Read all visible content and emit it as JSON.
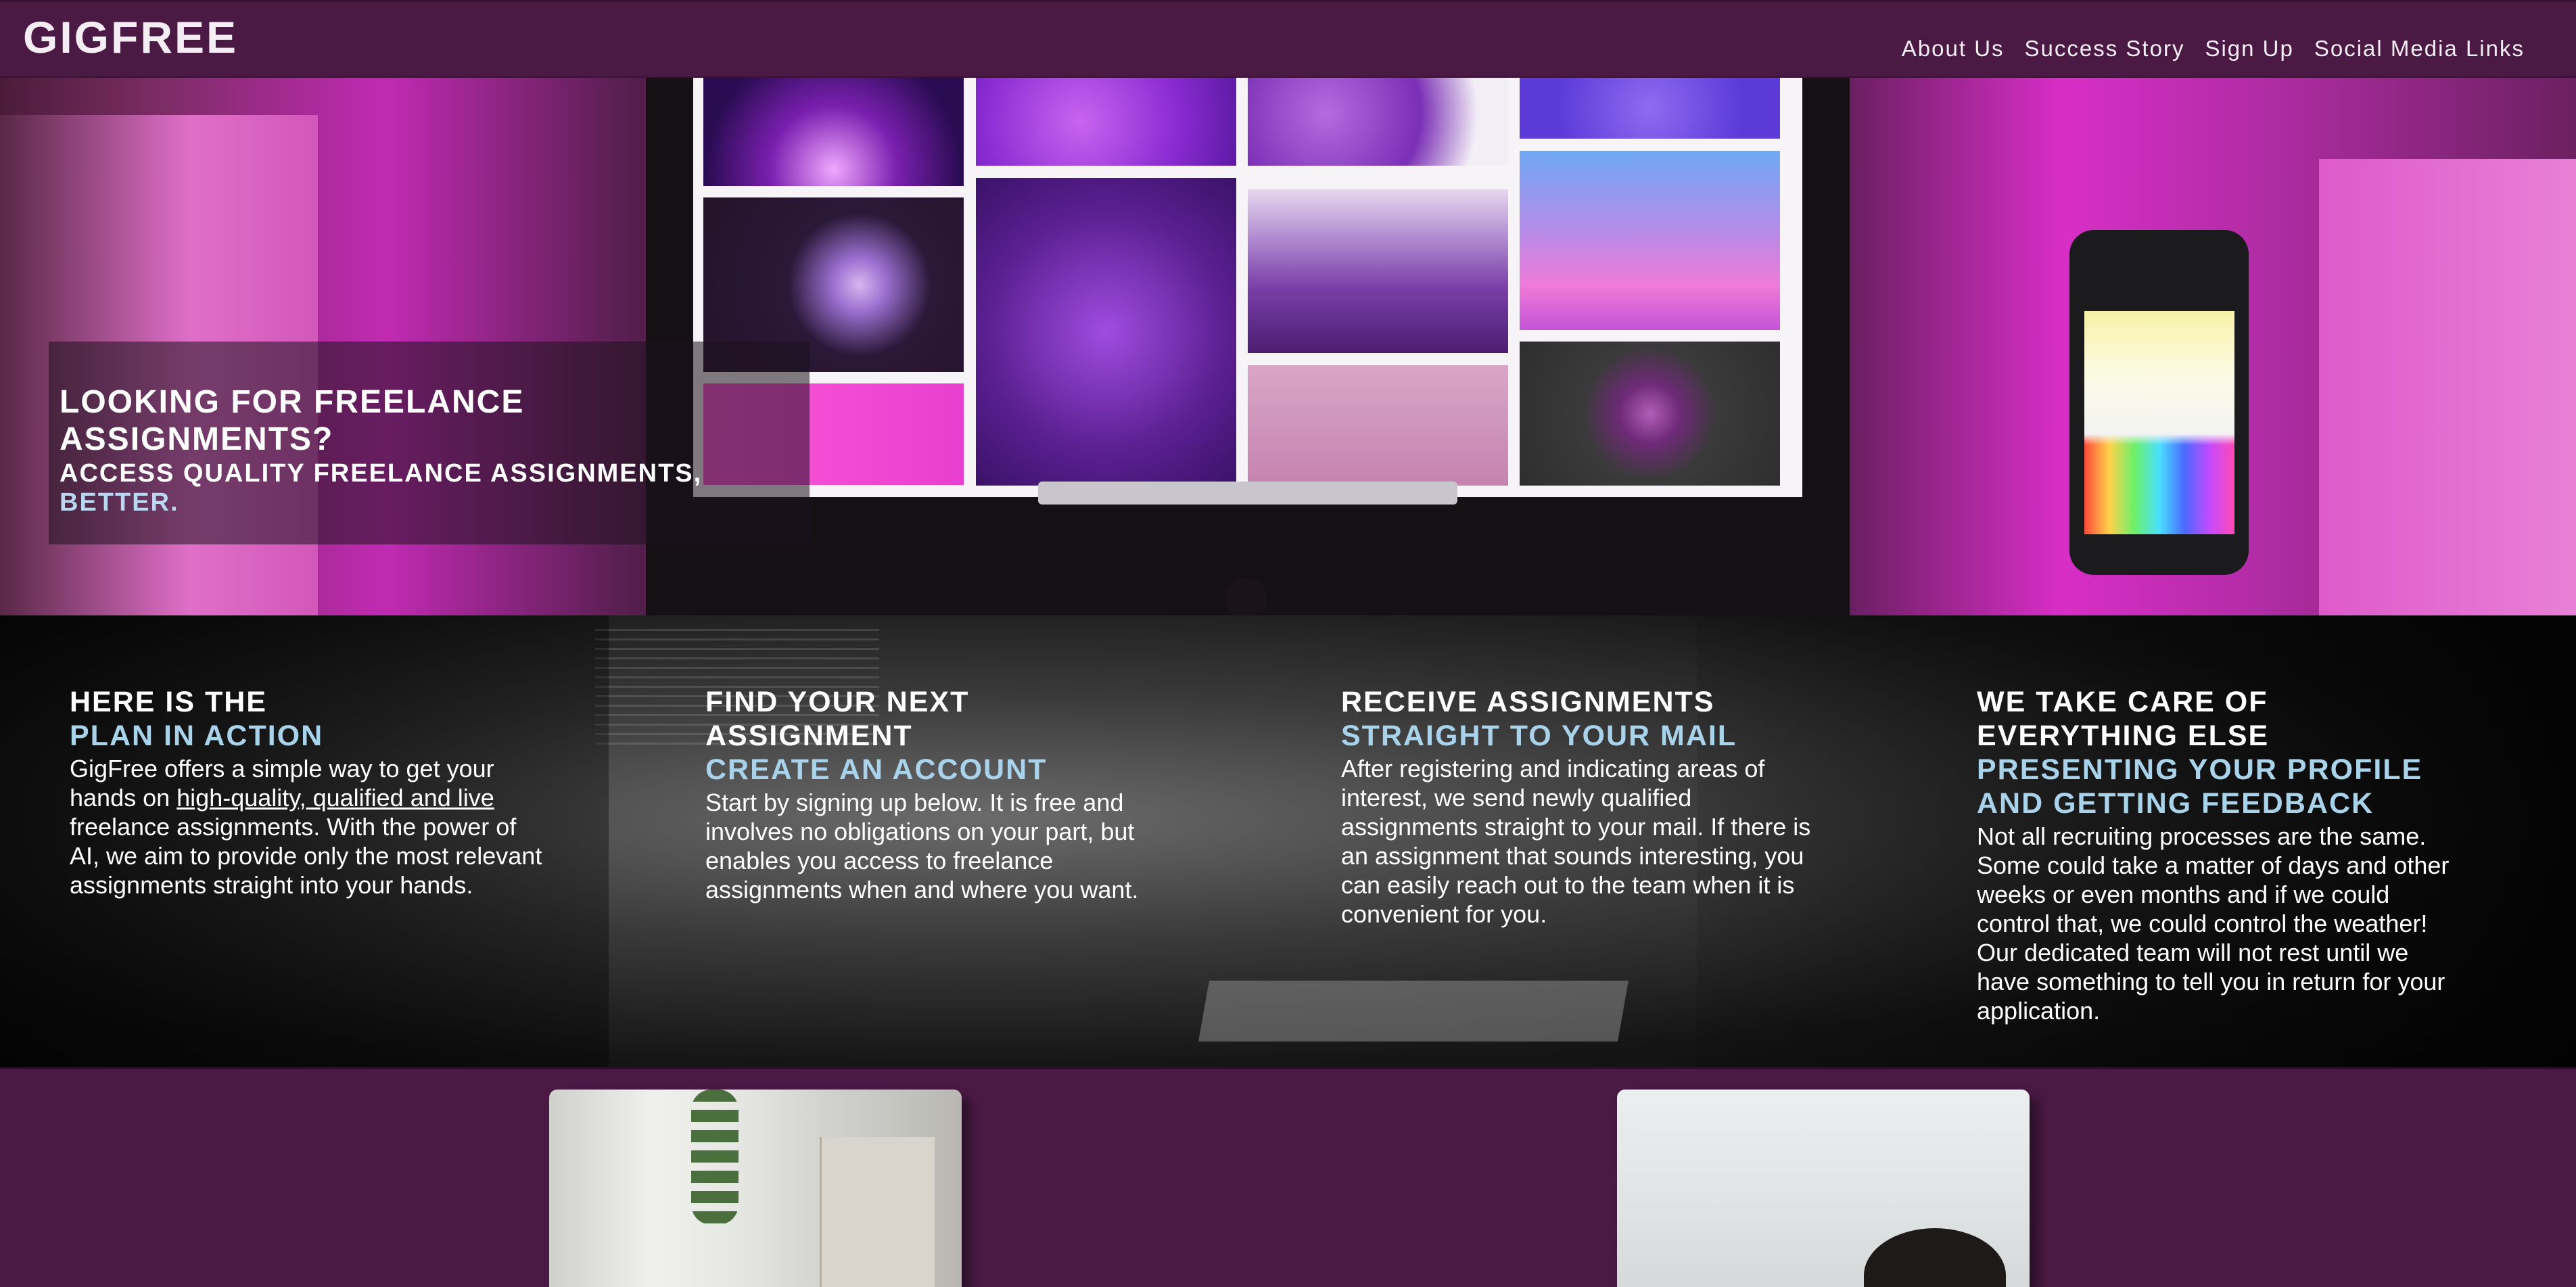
{
  "brand": "GIGFREE",
  "nav": {
    "links": [
      "About Us",
      "Success Story",
      "Sign Up",
      "Social Media Links"
    ]
  },
  "hero": {
    "heading": "LOOKING FOR FREELANCE ASSIGNMENTS?",
    "subheading_main": "ACCESS QUALITY FREELANCE ASSIGNMENTS,",
    "subheading_accent": "BETTER."
  },
  "plan": {
    "columns": [
      {
        "title_line1": "HERE IS THE",
        "title_accent": "PLAN IN ACTION",
        "body_pre": "GigFree offers a simple way to get your hands on",
        "body_link": "high-quality, qualified and live",
        "body_post": "freelance assignments. With the power of AI, we aim to provide only the most relevant assignments straight into your hands."
      },
      {
        "title_line1": "FIND YOUR NEXT ASSIGNMENT",
        "title_accent": "CREATE AN ACCOUNT",
        "body": "Start by signing up below. It is free and involves no obligations on your part, but enables you access to freelance assignments when and where you want."
      },
      {
        "title_line1": "RECEIVE ASSIGNMENTS",
        "title_accent": "STRAIGHT TO YOUR MAIL",
        "body": "After registering and indicating areas of interest, we send newly qualified assignments straight to your mail. If there is an assignment that sounds interesting, you can easily reach out to the team when it is convenient for you."
      },
      {
        "title_line1": "WE TAKE CARE OF EVERYTHING ELSE",
        "title_accent": "PRESENTING YOUR PROFILE AND GETTING FEEDBACK",
        "body": "Not all recruiting processes are the same. Some could take a matter of days and other weeks or even months and if we could control that, we could control the weather! Our dedicated team will not rest until we have something to tell you in return for your application."
      }
    ]
  },
  "colors": {
    "brand_purple": "#4a1a45",
    "accent_blue": "#a9d3ea",
    "hero_magenta": "#d82ec7"
  }
}
